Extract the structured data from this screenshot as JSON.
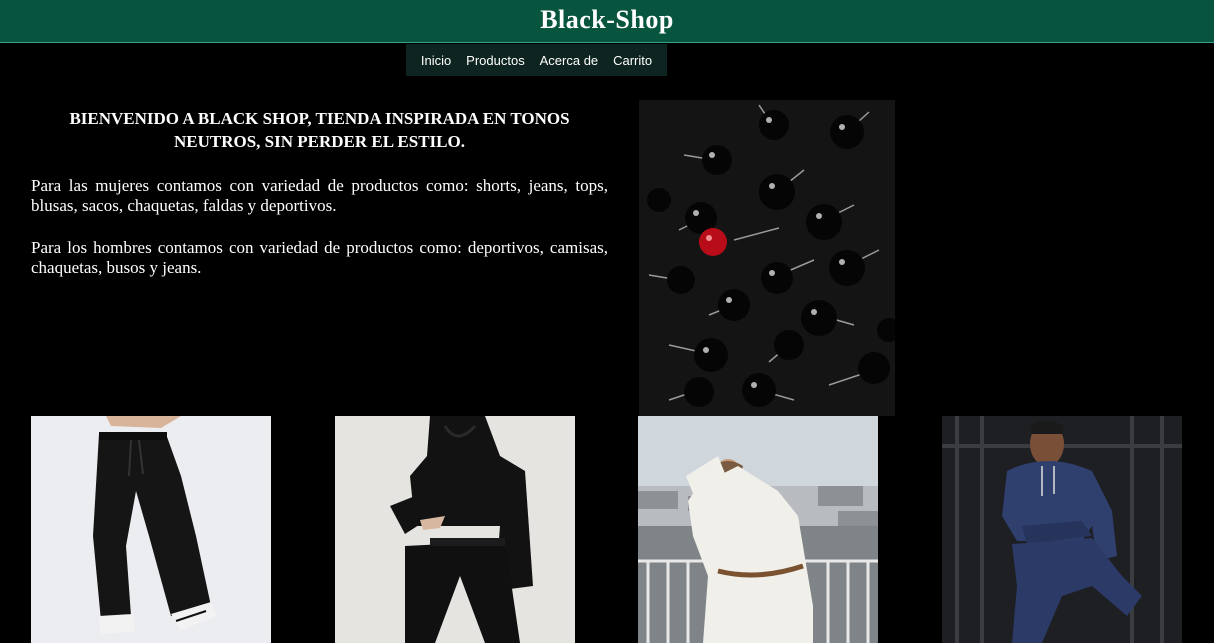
{
  "header": {
    "title": "Black-Shop"
  },
  "nav": {
    "items": [
      "Inicio",
      "Productos",
      "Acerca de",
      "Carrito"
    ]
  },
  "intro": {
    "welcome": "BIENVENIDO A BLACK SHOP, TIENDA INSPIRADA EN TONOS NEUTROS, SIN PERDER EL ESTILO.",
    "women_text": "Para las mujeres contamos con variedad de productos como: shorts, jeans, tops, blusas, sacos, chaquetas, faldas y deportivos.",
    "men_text": "Para los hombres contamos con variedad de productos como: deportivos, camisas, chaquetas, busos y jeans."
  },
  "images": {
    "hero": "black cherries with one red cherry",
    "products": [
      "black sweatpants",
      "black hoodie set",
      "white sweater",
      "blue tracksuit"
    ]
  },
  "colors": {
    "header_bg": "#07553f",
    "nav_bg": "#0e2421",
    "page_bg": "#000000",
    "text": "#ffffff"
  }
}
